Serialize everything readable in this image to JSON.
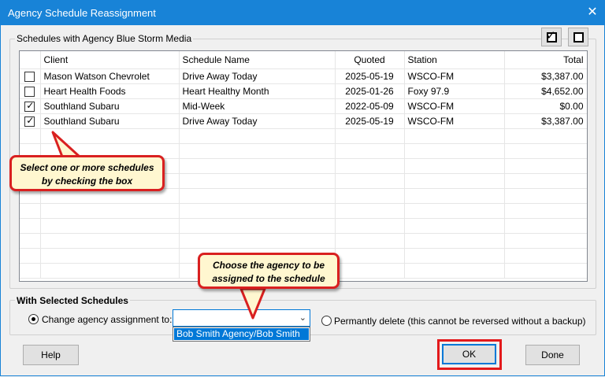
{
  "window": {
    "title": "Agency Schedule Reassignment",
    "close_glyph": "✕"
  },
  "schedules_group": {
    "label": "Schedules with Agency Blue Storm Media",
    "select_all_glyph": "✓",
    "columns": [
      "",
      "Client",
      "Schedule Name",
      "Quoted",
      "Station",
      "Total"
    ],
    "rows": [
      {
        "checked": false,
        "client": "Mason Watson Chevrolet",
        "schedule": "Drive Away Today",
        "quoted": "2025-05-19",
        "station": "WSCO-FM",
        "total": "$3,387.00"
      },
      {
        "checked": false,
        "client": "Heart Health Foods",
        "schedule": "Heart Healthy Month",
        "quoted": "2025-01-26",
        "station": "Foxy 97.9",
        "total": "$4,652.00"
      },
      {
        "checked": true,
        "client": "Southland Subaru",
        "schedule": "Mid-Week",
        "quoted": "2022-05-09",
        "station": "WSCO-FM",
        "total": "$0.00"
      },
      {
        "checked": true,
        "client": "Southland Subaru",
        "schedule": "Drive Away Today",
        "quoted": "2025-05-19",
        "station": "WSCO-FM",
        "total": "$3,387.00"
      }
    ]
  },
  "selected_group": {
    "label": "With Selected Schedules",
    "change_label": "Change agency assignment to:",
    "change_selected": true,
    "combo_value": "",
    "combo_arrow": "⌄",
    "combo_option": "Bob Smith Agency/Bob Smith",
    "delete_label": "Permantly delete (this cannot be reversed without a backup)",
    "delete_selected": false
  },
  "buttons": {
    "help": "Help",
    "ok": "OK",
    "done": "Done"
  },
  "callouts": {
    "select_line1": "Select one or more schedules",
    "select_line2": "by checking the box",
    "agency_line1": "Choose the agency to be",
    "agency_line2": "assigned to the schedule"
  },
  "colors": {
    "titlebar": "#1883d7",
    "callout_border": "#d92020",
    "callout_fill": "#fff7d0",
    "highlight": "#e3191b"
  }
}
